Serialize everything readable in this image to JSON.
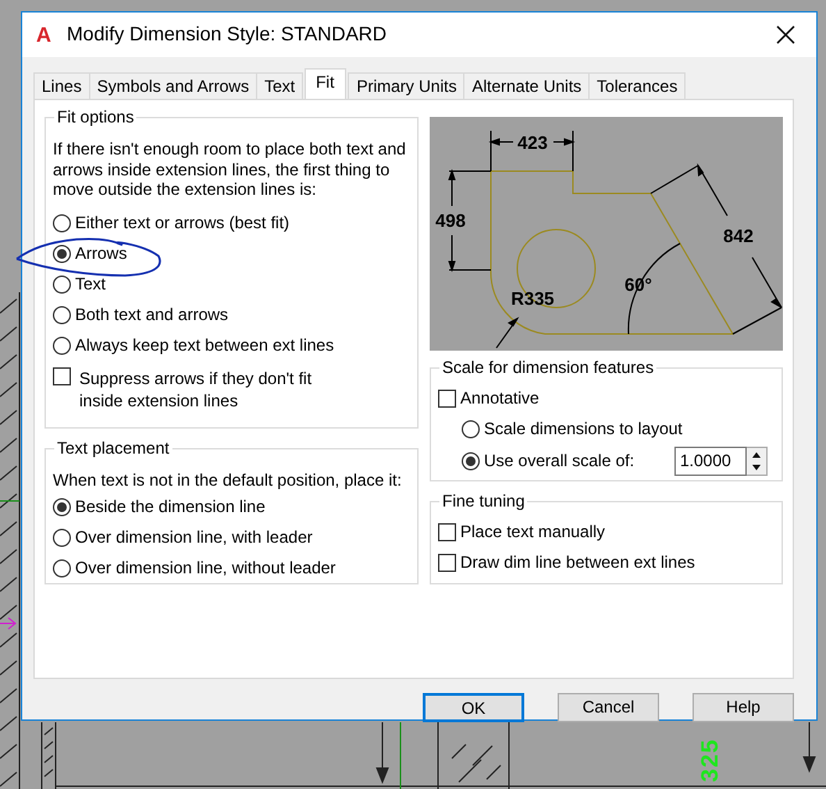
{
  "window": {
    "app_icon": "A",
    "title": "Modify Dimension Style: STANDARD"
  },
  "tabs": [
    {
      "label": "Lines",
      "selected": false
    },
    {
      "label": "Symbols and Arrows",
      "selected": false
    },
    {
      "label": "Text",
      "selected": false
    },
    {
      "label": "Fit",
      "selected": true
    },
    {
      "label": "Primary Units",
      "selected": false
    },
    {
      "label": "Alternate Units",
      "selected": false
    },
    {
      "label": "Tolerances",
      "selected": false
    }
  ],
  "fit_options": {
    "title": "Fit options",
    "description": "If there isn't enough room to place both text and arrows inside extension lines, the first thing to move outside the extension lines is:",
    "options": [
      {
        "label": "Either text or arrows (best fit)",
        "selected": false
      },
      {
        "label": "Arrows",
        "selected": true
      },
      {
        "label": "Text",
        "selected": false
      },
      {
        "label": "Both text and arrows",
        "selected": false
      },
      {
        "label": "Always keep text between ext lines",
        "selected": false
      }
    ],
    "suppress": {
      "label": "Suppress arrows if they don't fit inside extension lines",
      "checked": false
    }
  },
  "text_placement": {
    "title": "Text placement",
    "description": "When text is not in the default position, place it:",
    "options": [
      {
        "label": "Beside the dimension line",
        "selected": true
      },
      {
        "label": "Over dimension line, with leader",
        "selected": false
      },
      {
        "label": "Over dimension line, without leader",
        "selected": false
      }
    ]
  },
  "preview": {
    "labels": [
      "423",
      "498",
      "842",
      "R335",
      "60°"
    ]
  },
  "scale": {
    "title": "Scale for dimension features",
    "annotative": {
      "label": "Annotative",
      "checked": false
    },
    "options": [
      {
        "label": "Scale dimensions to layout",
        "selected": false
      },
      {
        "label": "Use overall scale of:",
        "selected": true
      }
    ],
    "value": "1.0000"
  },
  "fine_tuning": {
    "title": "Fine tuning",
    "items": [
      {
        "label": "Place text manually",
        "checked": false
      },
      {
        "label": "Draw dim line between ext lines",
        "checked": false
      }
    ]
  },
  "buttons": [
    {
      "label": "OK",
      "default": true
    },
    {
      "label": "Cancel",
      "default": false
    },
    {
      "label": "Help",
      "default": false
    }
  ],
  "background": {
    "dimension_text": "325"
  }
}
